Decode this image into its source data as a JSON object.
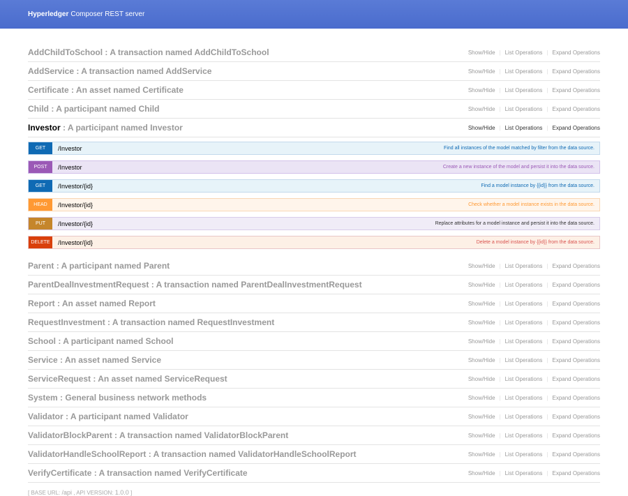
{
  "header": {
    "brand": "Hyperledger",
    "title": "Composer REST server"
  },
  "ops_labels": {
    "show_hide": "Show/Hide",
    "list": "List Operations",
    "expand": "Expand Operations"
  },
  "resources": [
    {
      "name": "AddChildToSchool",
      "desc": " : A transaction named AddChildToSchool"
    },
    {
      "name": "AddService",
      "desc": " : A transaction named AddService"
    },
    {
      "name": "Certificate",
      "desc": " : An asset named Certificate"
    },
    {
      "name": "Child",
      "desc": " : A participant named Child"
    },
    {
      "name": "Investor",
      "desc": " : A participant named Investor"
    },
    {
      "name": "Parent",
      "desc": " : A participant named Parent"
    },
    {
      "name": "ParentDealInvestmentRequest",
      "desc": " : A transaction named ParentDealInvestmentRequest"
    },
    {
      "name": "Report",
      "desc": " : An asset named Report"
    },
    {
      "name": "RequestInvestment",
      "desc": " : A transaction named RequestInvestment"
    },
    {
      "name": "School",
      "desc": " : A participant named School"
    },
    {
      "name": "Service",
      "desc": " : An asset named Service"
    },
    {
      "name": "ServiceRequest",
      "desc": " : An asset named ServiceRequest"
    },
    {
      "name": "System",
      "desc": " : General business network methods"
    },
    {
      "name": "Validator",
      "desc": " : A participant named Validator"
    },
    {
      "name": "ValidatorBlockParent",
      "desc": " : A transaction named ValidatorBlockParent"
    },
    {
      "name": "ValidatorHandleSchoolReport",
      "desc": " : A transaction named ValidatorHandleSchoolReport"
    },
    {
      "name": "VerifyCertificate",
      "desc": " : A transaction named VerifyCertificate"
    }
  ],
  "endpoints": [
    {
      "method": "get",
      "path": "/Investor",
      "summary": "Find all instances of the model matched by filter from the data source."
    },
    {
      "method": "post",
      "path": "/Investor",
      "summary": "Create a new instance of the model and persist it into the data source."
    },
    {
      "method": "get",
      "path": "/Investor/{id}",
      "summary": "Find a model instance by {{id}} from the data source."
    },
    {
      "method": "head",
      "path": "/Investor/{id}",
      "summary": "Check whether a model instance exists in the data source."
    },
    {
      "method": "put",
      "path": "/Investor/{id}",
      "summary": "Replace attributes for a model instance and persist it into the data source."
    },
    {
      "method": "delete",
      "path": "/Investor/{id}",
      "summary": "Delete a model instance by {{id}} from the data source."
    }
  ],
  "footer": {
    "base_url_label": "[ Base URL: ",
    "base_url": "/api",
    "version_label": " , Api Version: ",
    "version": "1.0.0",
    "close": " ]"
  }
}
